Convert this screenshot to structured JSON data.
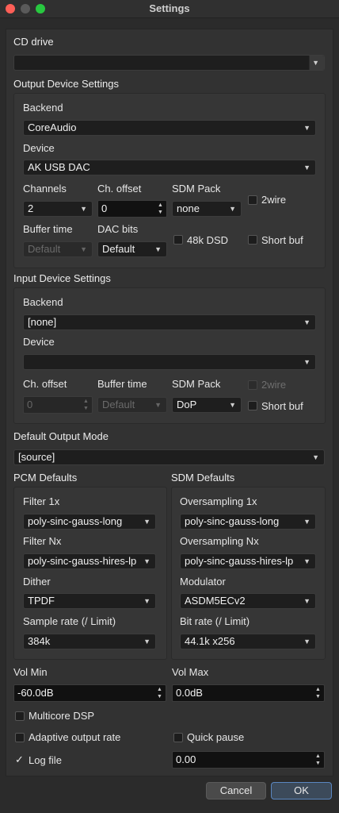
{
  "window": {
    "title": "Settings"
  },
  "cd": {
    "label": "CD drive",
    "value": ""
  },
  "output": {
    "section_title": "Output Device Settings",
    "backend_label": "Backend",
    "backend_value": "CoreAudio",
    "device_label": "Device",
    "device_value": "AK USB DAC",
    "channels_label": "Channels",
    "channels_value": "2",
    "choffset_label": "Ch. offset",
    "choffset_value": "0",
    "sdmpack_label": "SDM Pack",
    "sdmpack_value": "none",
    "twowire_label": "2wire",
    "buffer_label": "Buffer time",
    "buffer_value": "Default",
    "dacbits_label": "DAC bits",
    "dacbits_value": "Default",
    "dsd48_label": "48k DSD",
    "shortbuf_label": "Short buf"
  },
  "input": {
    "section_title": "Input Device Settings",
    "backend_label": "Backend",
    "backend_value": "[none]",
    "device_label": "Device",
    "device_value": "",
    "choffset_label": "Ch. offset",
    "choffset_value": "0",
    "buffer_label": "Buffer time",
    "buffer_value": "Default",
    "sdmpack_label": "SDM Pack",
    "sdmpack_value": "DoP",
    "twowire_label": "2wire",
    "shortbuf_label": "Short buf"
  },
  "mode": {
    "label": "Default Output Mode",
    "value": "[source]"
  },
  "pcm": {
    "section_title": "PCM Defaults",
    "filter1x_label": "Filter 1x",
    "filter1x_value": "poly-sinc-gauss-long",
    "filternx_label": "Filter Nx",
    "filternx_value": "poly-sinc-gauss-hires-lp",
    "dither_label": "Dither",
    "dither_value": "TPDF",
    "samplerate_label": "Sample rate (/ Limit)",
    "samplerate_value": "384k"
  },
  "sdm": {
    "section_title": "SDM Defaults",
    "os1x_label": "Oversampling 1x",
    "os1x_value": "poly-sinc-gauss-long",
    "osnx_label": "Oversampling Nx",
    "osnx_value": "poly-sinc-gauss-hires-lp",
    "modulator_label": "Modulator",
    "modulator_value": "ASDM5ECv2",
    "bitrate_label": "Bit rate (/ Limit)",
    "bitrate_value": "44.1k x256"
  },
  "vol": {
    "min_label": "Vol Min",
    "min_value": "-60.0dB",
    "max_label": "Vol Max",
    "max_value": "0.0dB"
  },
  "options": {
    "multicore_label": "Multicore DSP",
    "adaptive_label": "Adaptive output rate",
    "quickpause_label": "Quick pause",
    "logfile_label": "Log file",
    "logfile_check": "✓",
    "logfile_value": "0.00"
  },
  "buttons": {
    "cancel": "Cancel",
    "ok": "OK"
  }
}
